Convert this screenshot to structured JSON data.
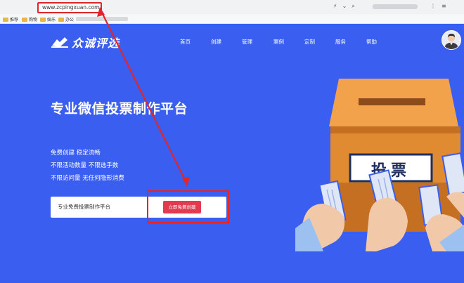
{
  "browser": {
    "url": "www.zcpingxuan.com",
    "bookmarks": [
      {
        "label": "推荐"
      },
      {
        "label": "购物"
      },
      {
        "label": "娱乐"
      },
      {
        "label": "办公"
      }
    ]
  },
  "site": {
    "logo_text": "众诚评选",
    "nav": [
      "首页",
      "创建",
      "管理",
      "案例",
      "定制",
      "服务",
      "帮助"
    ]
  },
  "hero": {
    "title": "专业微信投票制作平台",
    "lines": [
      "免费创建 稳定流畅",
      "不限活动数量 不限选手数",
      "不限访问量 无任何隐形消费"
    ],
    "search_text": "专业免费投票制作平台",
    "button_label": "立即免费创建"
  },
  "illustration": {
    "box_label": "投票"
  },
  "colors": {
    "page_bg": "#3a5ef0",
    "accent_red": "#e23a4e",
    "annotation_red": "#e0252b",
    "box_orange": "#e08a32"
  }
}
